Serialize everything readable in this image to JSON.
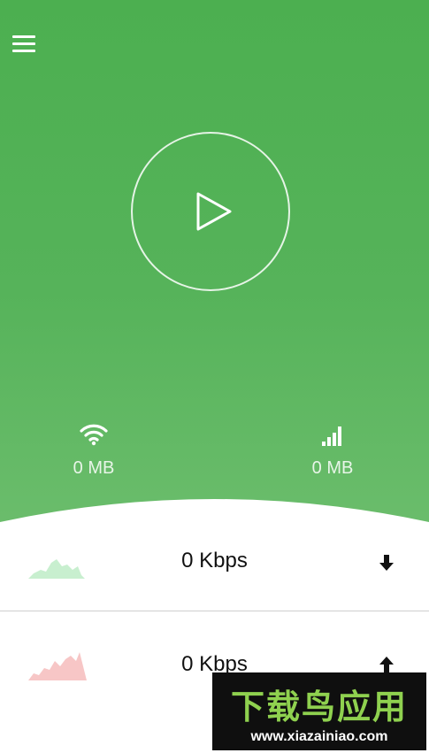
{
  "header": {
    "menu_icon": "hamburger-menu-icon"
  },
  "control": {
    "icon": "play-icon"
  },
  "stats": {
    "wifi": {
      "icon": "wifi-icon",
      "value": "0 MB"
    },
    "cellular": {
      "icon": "cellular-signal-icon",
      "value": "0 MB"
    }
  },
  "rows": [
    {
      "graph": "download-graph",
      "speed": "0 Kbps",
      "icon": "download-arrow-icon",
      "color": "#c8efcf"
    },
    {
      "graph": "upload-graph",
      "speed": "0 Kbps",
      "icon": "upload-arrow-icon",
      "color": "#f7c6c6"
    }
  ],
  "colors": {
    "accent": "#4caf50"
  },
  "watermark": {
    "title": "下载鸟应用",
    "url": "www.xiazainiao.com"
  }
}
